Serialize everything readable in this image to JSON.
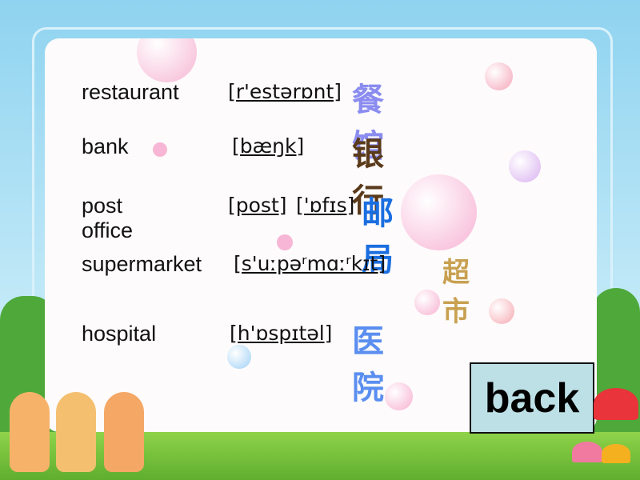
{
  "vocabulary": [
    {
      "word": "restaurant",
      "phonetic": "[r'estərɒnt]",
      "chinese": "餐馆",
      "color": "#8a8cf0"
    },
    {
      "word": "bank",
      "phonetic": "[bæŋk]",
      "chinese": "银行",
      "color": "#5a3a1a"
    },
    {
      "word": "post office",
      "phonetic_1": "[post]",
      "phonetic_2": "['ɒfɪs]",
      "chinese": "邮局",
      "color": "#1a6ee0"
    },
    {
      "word": "supermarket",
      "phonetic": "[s'uːpəʳmɑːʳkɪt]",
      "chinese": "超市",
      "color": "#c8a050"
    },
    {
      "word": "hospital",
      "phonetic": "[h'ɒspɪtəl]",
      "chinese": "医院",
      "color": "#5a8ef0"
    }
  ],
  "back_button": {
    "label": "back",
    "color": "#bde0e6"
  }
}
